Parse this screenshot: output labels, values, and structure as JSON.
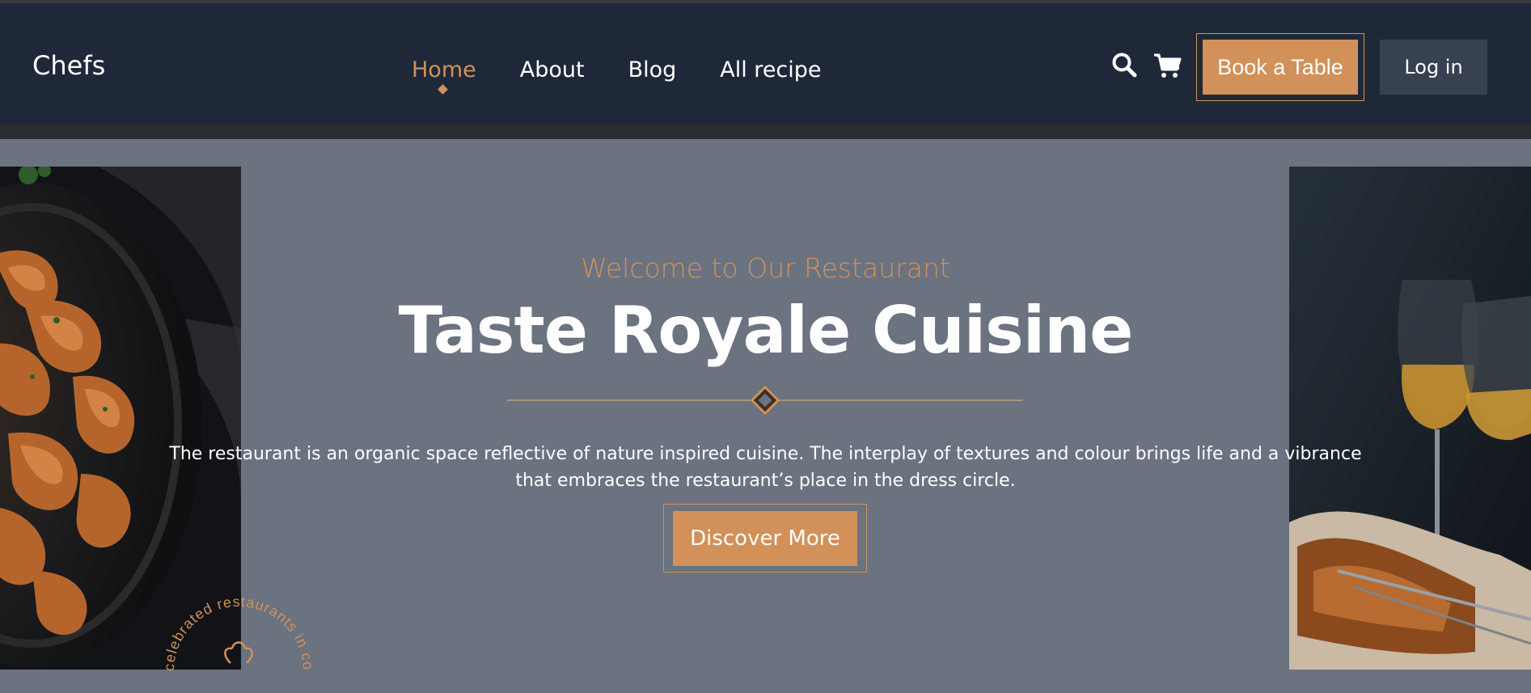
{
  "header": {
    "brand": "Chefs",
    "nav": [
      {
        "label": "Home",
        "active": true
      },
      {
        "label": "About",
        "active": false
      },
      {
        "label": "Blog",
        "active": false
      },
      {
        "label": "All recipe",
        "active": false
      }
    ],
    "icons": {
      "search": "search-icon",
      "cart": "cart-icon"
    },
    "book_label": "Book a Table",
    "login_label": "Log in"
  },
  "hero": {
    "subtitle": "Welcome to Our Restaurant",
    "title": "Taste Royale Cuisine",
    "description": "The restaurant is an organic space reflective of nature inspired cuisine. The interplay of textures and colour brings life and a vibrance that embraces the restaurant’s place in the dress circle.",
    "cta_label": "Discover More",
    "badge_text": "celebrated restaurants in co",
    "images": {
      "left": "shrimp-pan-photo",
      "right": "wine-glasses-photo"
    }
  },
  "colors": {
    "accent": "#d19158",
    "nav_bg": "#1f2839",
    "hero_bg": "#6b7280",
    "login_bg": "#374151"
  }
}
